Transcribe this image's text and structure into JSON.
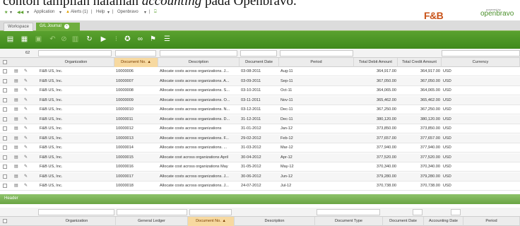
{
  "caption": {
    "text_before": "contoh tampilan halaman ",
    "text_italic": "accounting",
    "text_after": " pada Openbravo."
  },
  "nav": {
    "star": "★",
    "recent": "Application",
    "alerts": "Alerts (1)",
    "help": "Help",
    "openbravo": "Openbravo",
    "logout": "⍈"
  },
  "brand": {
    "fb": "F&B",
    "ob": "openbravo",
    "ob_small": "powered by"
  },
  "tabs": {
    "workspace": "Workspace",
    "gl_journal": "G/L Journal"
  },
  "filter": {
    "count": "62"
  },
  "columns": [
    "Organization",
    "Document No. ▲",
    "Description",
    "Document Date",
    "Period",
    "Total Debit Amount",
    "Total Credit Amount",
    "Currency"
  ],
  "rows": [
    {
      "org": "F&B US, Inc.",
      "doc": "10000006",
      "desc": "Allocate costs across organizations. J...",
      "date": "03-08-2011",
      "period": "Aug-11",
      "debit": "364,917.00",
      "credit": "364,917.00",
      "cur": "USD"
    },
    {
      "org": "F&B US, Inc.",
      "doc": "10000007",
      "desc": "Allocate costs across organizations. A...",
      "date": "03-09-2011",
      "period": "Sep-11",
      "debit": "367,050.00",
      "credit": "367,050.00",
      "cur": "USD"
    },
    {
      "org": "F&B US, Inc.",
      "doc": "10000008",
      "desc": "Allocate costs across organizations. S...",
      "date": "03-10-2011",
      "period": "Oct-11",
      "debit": "364,065.00",
      "credit": "364,065.00",
      "cur": "USD"
    },
    {
      "org": "F&B US, Inc.",
      "doc": "10000009",
      "desc": "Allocate costs across organizations. O...",
      "date": "03-11-2011",
      "period": "Nov-11",
      "debit": "365,462.00",
      "credit": "365,462.00",
      "cur": "USD"
    },
    {
      "org": "F&B US, Inc.",
      "doc": "10000010",
      "desc": "Allocate costs across organizations. N...",
      "date": "03-12-2011",
      "period": "Dec-11",
      "debit": "367,250.00",
      "credit": "367,250.00",
      "cur": "USD"
    },
    {
      "org": "F&B US, Inc.",
      "doc": "10000011",
      "desc": "Allocate costs across organizations. D...",
      "date": "31-12-2011",
      "period": "Dec-11",
      "debit": "380,120.00",
      "credit": "380,120.00",
      "cur": "USD"
    },
    {
      "org": "F&B US, Inc.",
      "doc": "10000012",
      "desc": "Allocate costs across organizations",
      "date": "31-01-2012",
      "period": "Jan-12",
      "debit": "373,850.00",
      "credit": "373,850.00",
      "cur": "USD"
    },
    {
      "org": "F&B US, Inc.",
      "doc": "10000013",
      "desc": "Allocate costs across organizations. F...",
      "date": "29-02-2012",
      "period": "Feb-12",
      "debit": "377,657.00",
      "credit": "377,657.00",
      "cur": "USD"
    },
    {
      "org": "F&B US, Inc.",
      "doc": "10000014",
      "desc": "Allocate costs across organizations. ...",
      "date": "31-03-2012",
      "period": "Mar-12",
      "debit": "377,940.00",
      "credit": "377,940.00",
      "cur": "USD"
    },
    {
      "org": "F&B US, Inc.",
      "doc": "10000015",
      "desc": "Allocate cost across organizations April",
      "date": "30-04-2012",
      "period": "Apr-12",
      "debit": "377,520.00",
      "credit": "377,520.00",
      "cur": "USD"
    },
    {
      "org": "F&B US, Inc.",
      "doc": "10000016",
      "desc": "Allocate cost across organizations May",
      "date": "31-05-2012",
      "period": "May-12",
      "debit": "370,340.00",
      "credit": "370,340.00",
      "cur": "USD"
    },
    {
      "org": "F&B US, Inc.",
      "doc": "10000017",
      "desc": "Allocate costs across organizations. J...",
      "date": "30-06-2012",
      "period": "Jun-12",
      "debit": "379,280.00",
      "credit": "379,280.00",
      "cur": "USD"
    },
    {
      "org": "F&B US, Inc.",
      "doc": "10000018",
      "desc": "Allocate costs across organizations. J...",
      "date": "24-07-2012",
      "period": "Jul-12",
      "debit": "370,738.00",
      "credit": "370,738.00",
      "cur": "USD"
    }
  ],
  "section": {
    "header": "Header"
  },
  "columns2": [
    "Organization",
    "General Ledger",
    "Document No. ▲",
    "Description",
    "Document Type",
    "Document Date",
    "Accounting Date",
    "Period"
  ]
}
